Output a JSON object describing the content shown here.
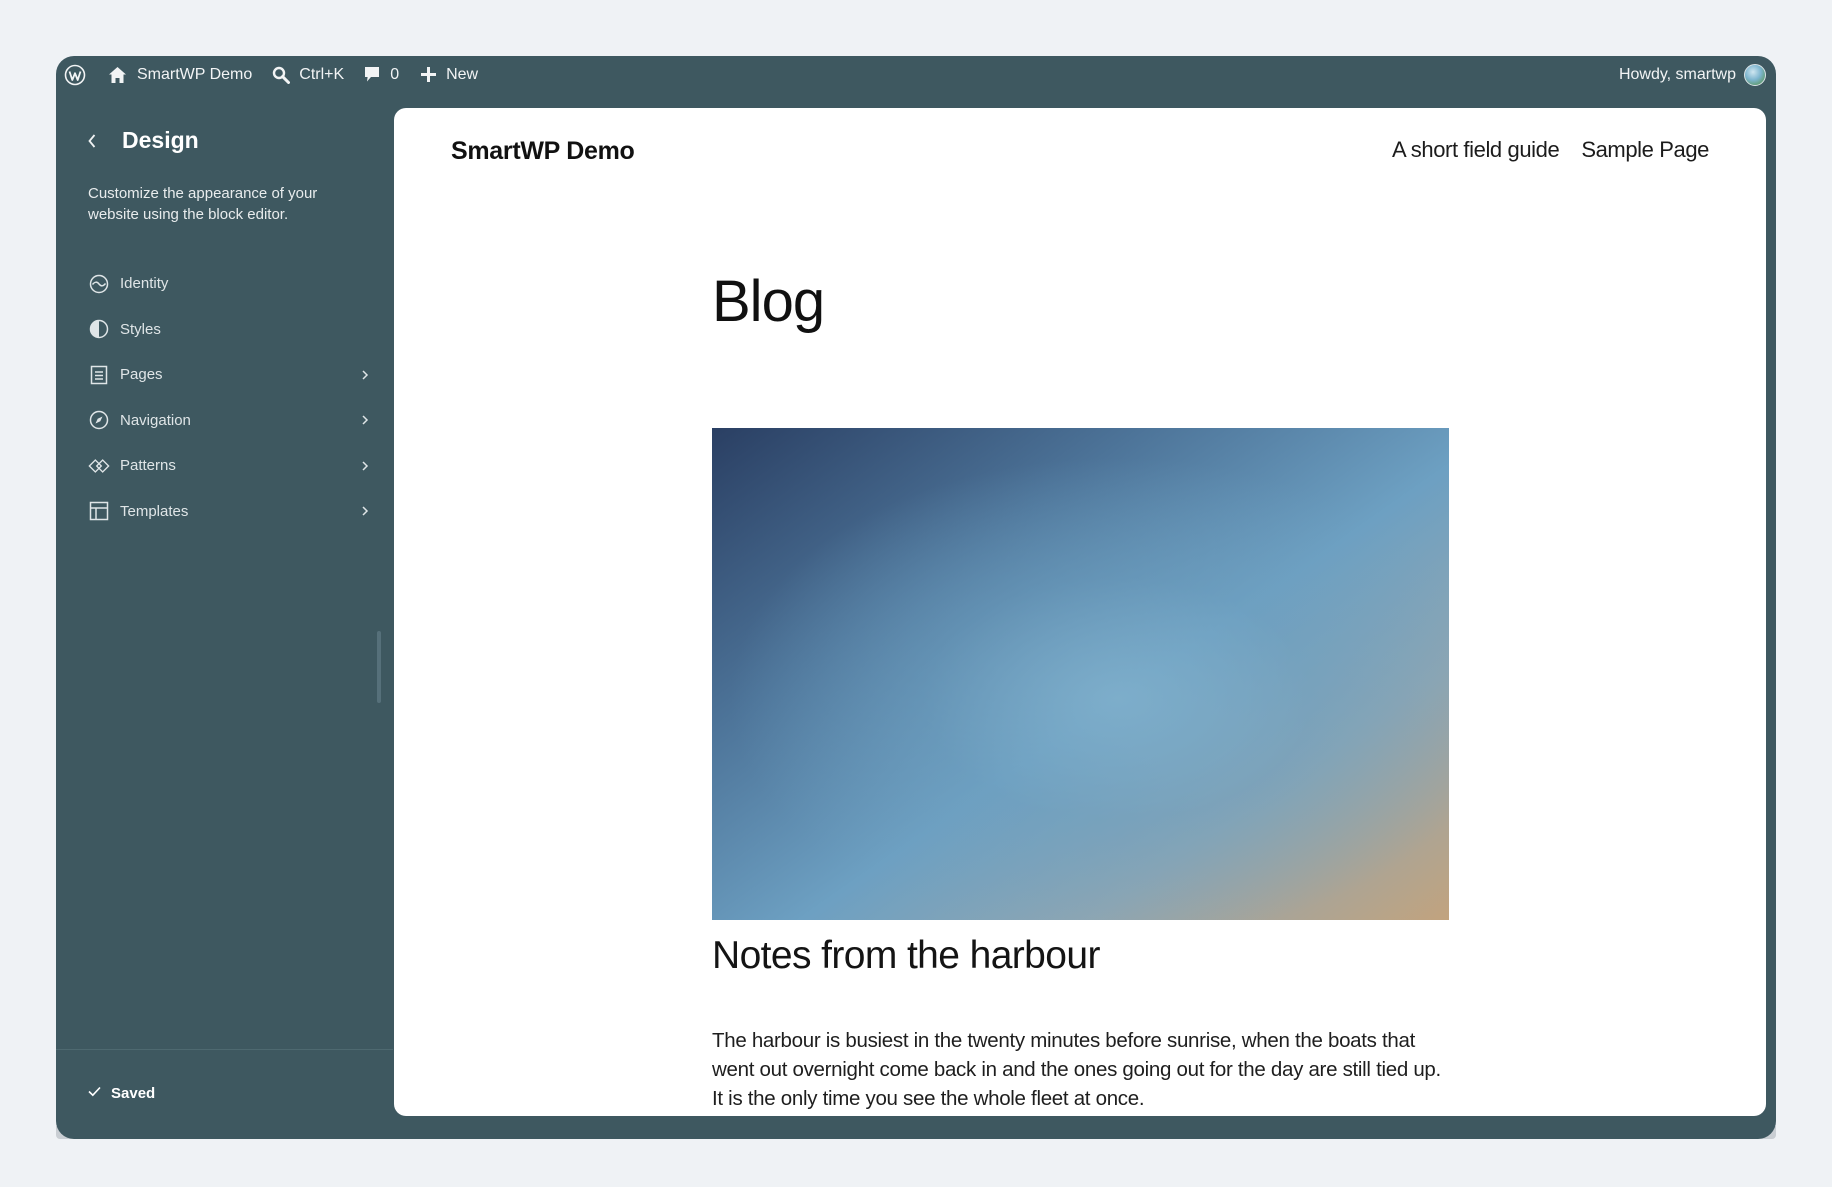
{
  "admin_bar": {
    "site_name": "SmartWP Demo",
    "search_shortcut": "Ctrl+K",
    "comments_count": "0",
    "new_label": "New",
    "greeting": "Howdy, smartwp"
  },
  "sidebar": {
    "title": "Design",
    "description": "Customize the appearance of your website using the block editor.",
    "items": [
      {
        "label": "Identity",
        "icon": "identity-icon",
        "has_chevron": false
      },
      {
        "label": "Styles",
        "icon": "styles-icon",
        "has_chevron": false
      },
      {
        "label": "Pages",
        "icon": "page-icon",
        "has_chevron": true
      },
      {
        "label": "Navigation",
        "icon": "navigation-icon",
        "has_chevron": true
      },
      {
        "label": "Patterns",
        "icon": "patterns-icon",
        "has_chevron": true
      },
      {
        "label": "Templates",
        "icon": "templates-icon",
        "has_chevron": true
      }
    ],
    "save_status": "Saved"
  },
  "preview": {
    "site_title": "SmartWP Demo",
    "nav": [
      "A short field guide",
      "Sample Page"
    ],
    "page_heading": "Blog",
    "post_title": "Notes from the harbour",
    "post_excerpt": "The harbour is busiest in the twenty minutes before sunrise, when the boats that went out overnight come back in and the ones going out for the day are still tied up. It is the only time you see the whole fleet at once."
  },
  "colors": {
    "chrome": "#3e5860",
    "background": "#eff2f5",
    "preview_bg": "#ffffff"
  }
}
